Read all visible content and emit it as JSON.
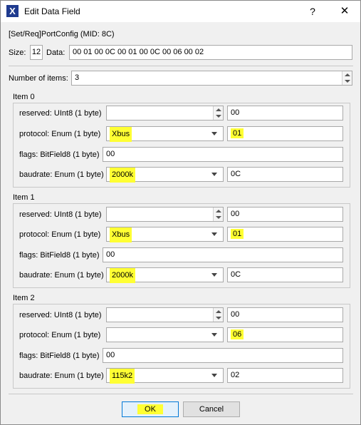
{
  "window": {
    "title": "Edit Data Field",
    "help_glyph": "?",
    "close_glyph": "✕",
    "app_icon_glyph": "X"
  },
  "message": {
    "name": "[Set/Req]PortConfig (MID: 8C)",
    "size_label": "Size:",
    "size_value": "12",
    "data_label": "Data:",
    "data_value": "00 01 00 0C 00 01 00 0C 00 06 00 02"
  },
  "num_items": {
    "label": "Number of items:",
    "value": "3"
  },
  "items": [
    {
      "title": "Item 0",
      "reserved": {
        "label": "reserved: UInt8 (1 byte)",
        "spin_value": "",
        "hex": "00"
      },
      "protocol": {
        "label": "protocol: Enum (1 byte)",
        "value": "Xbus",
        "hex": "01"
      },
      "flags": {
        "label": "flags: BitField8 (1 byte)",
        "value": "00"
      },
      "baudrate": {
        "label": "baudrate: Enum (1 byte)",
        "value": "2000k",
        "hex": "0C"
      }
    },
    {
      "title": "Item 1",
      "reserved": {
        "label": "reserved: UInt8 (1 byte)",
        "spin_value": "",
        "hex": "00"
      },
      "protocol": {
        "label": "protocol: Enum (1 byte)",
        "value": "Xbus",
        "hex": "01"
      },
      "flags": {
        "label": "flags: BitField8 (1 byte)",
        "value": "00"
      },
      "baudrate": {
        "label": "baudrate: Enum (1 byte)",
        "value": "2000k",
        "hex": "0C"
      }
    },
    {
      "title": "Item 2",
      "reserved": {
        "label": "reserved: UInt8 (1 byte)",
        "spin_value": "",
        "hex": "00"
      },
      "protocol": {
        "label": "protocol: Enum (1 byte)",
        "value": "",
        "hex": "06"
      },
      "flags": {
        "label": "flags: BitField8 (1 byte)",
        "value": "00"
      },
      "baudrate": {
        "label": "baudrate: Enum (1 byte)",
        "value": "115k2",
        "hex": "02"
      }
    }
  ],
  "buttons": {
    "ok": "OK",
    "cancel": "Cancel"
  },
  "colors": {
    "highlight": "#ffff33",
    "default_button_border": "#0078d7",
    "app_icon": "#1f3b8f"
  }
}
